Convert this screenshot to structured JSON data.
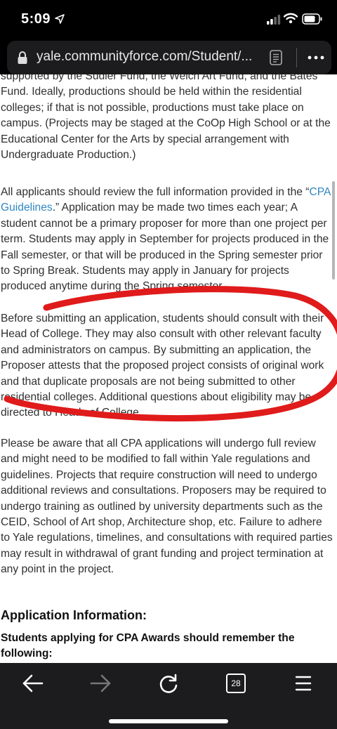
{
  "status_bar": {
    "time": "5:09"
  },
  "browser": {
    "url": "yale.communityforce.com/Student/...",
    "tab_count": "28"
  },
  "article": {
    "p1": "supported by the Sudler Fund, the Welch Art Fund, and the Bates Fund. Ideally, productions should be held within the residential colleges; if that is not possible, productions must take place on campus. (Projects may be staged at the CoOp High School or at the Educational Center for the Arts by special arrangement with Undergraduate Production.)",
    "p2_before": "All applicants should review the full information provided in the “",
    "p2_link": "CPA Guidelines",
    "p2_after": ".” Application may be made two times each year; A student cannot be a primary proposer for more than one project per term. Students may apply in September for projects produced in the Fall semester, or that will be produced in the Spring semester prior to Spring Break. Students may apply in January for projects produced anytime during the Spring semester.",
    "p3": "Before submitting an application, students should consult with their Head of College. They may also consult with other relevant faculty and administrators on campus.  By submitting an application, the Proposer attests that the proposed project consists of original work and that duplicate proposals are not being submitted to other residential colleges. Additional questions about eligibility may be directed to Heads of College.",
    "p4": "Please be aware that all CPA applications will undergo full review and might need to be modified to fall within Yale regulations and guidelines. Projects that require construction will need to undergo additional reviews and consultations. Proposers may be required to undergo training as outlined by university departments such as the CEID, School of Art shop, Architecture shop, etc.  Failure to adhere to Yale regulations, timelines, and consultations with required parties may result in withdrawal of grant funding and project termination at any point in the project.",
    "heading": "Application Information:",
    "subheading": "Students applying for CPA Awards should remember the following:"
  },
  "colors": {
    "link": "#2f86c2",
    "annotation": "#e01b1b",
    "toolbar": "#1c1c1e"
  },
  "icons": [
    "location-arrow-icon",
    "signal-icon",
    "wifi-icon",
    "battery-icon",
    "lock-icon",
    "reader-icon",
    "more-icon",
    "back-icon",
    "forward-icon",
    "reload-icon",
    "tabs-icon",
    "menu-icon"
  ]
}
